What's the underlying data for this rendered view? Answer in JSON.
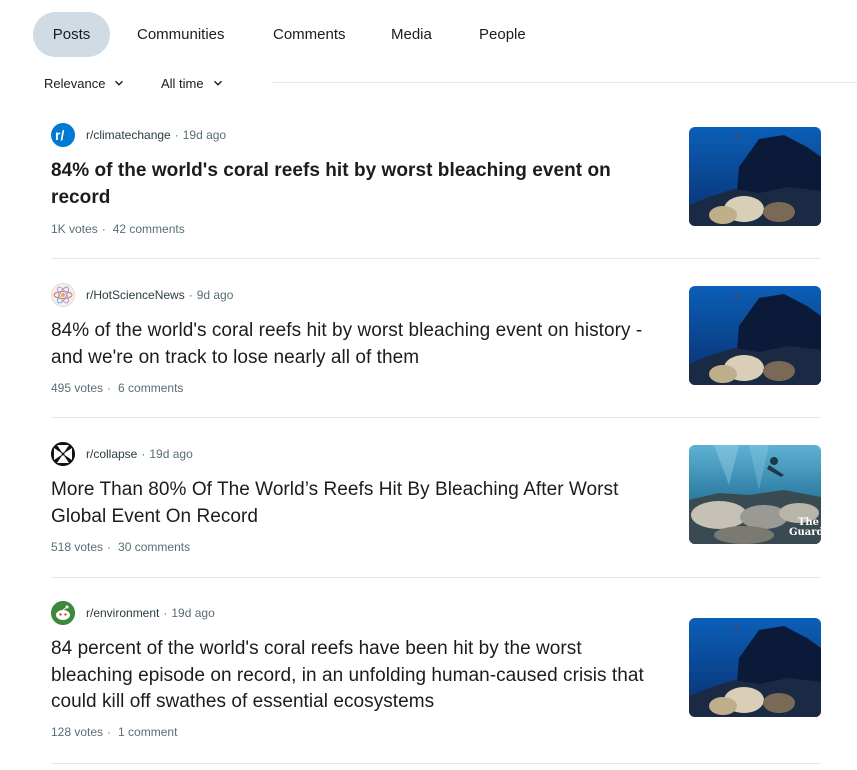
{
  "tabs": [
    {
      "label": "Posts",
      "active": true
    },
    {
      "label": "Communities",
      "active": false
    },
    {
      "label": "Comments",
      "active": false
    },
    {
      "label": "Media",
      "active": false
    },
    {
      "label": "People",
      "active": false
    }
  ],
  "filters": {
    "sort": "Relevance",
    "time": "All time"
  },
  "posts": [
    {
      "subreddit": "r/climatechange",
      "age": "19d ago",
      "title": "84% of the world's coral reefs hit by worst bleaching event on record",
      "votes": "1K votes",
      "comments": "42 comments",
      "icon": "climatechange-community-icon",
      "thumbnail": "coral-reef-thumbnail"
    },
    {
      "subreddit": "r/HotScienceNews",
      "age": "9d ago",
      "title": "84% of the world's coral reefs hit by worst bleaching event on history - and we're on track to lose nearly all of them",
      "votes": "495 votes",
      "comments": "6 comments",
      "icon": "atom-community-icon",
      "thumbnail": "coral-reef-thumbnail"
    },
    {
      "subreddit": "r/collapse",
      "age": "19d ago",
      "title": "More Than 80% Of The World’s Reefs Hit By Bleaching After Worst Global Event On Record",
      "votes": "518 votes",
      "comments": "30 comments",
      "icon": "cross-community-icon",
      "thumbnail": "diver-reef-thumbnail",
      "thumbnail_watermark": "The Guardian"
    },
    {
      "subreddit": "r/environment",
      "age": "19d ago",
      "title": "84 percent of the world's coral reefs have been hit by the worst bleaching episode on record, in an unfolding human-caused crisis that could kill off swathes of essential ecosystems",
      "votes": "128 votes",
      "comments": "1 comment",
      "icon": "snoo-community-icon",
      "thumbnail": "coral-reef-thumbnail"
    }
  ],
  "colors": {
    "active_tab_bg": "#d0dbe3",
    "meta_text": "#576f76",
    "divider": "#e4e7e9",
    "climatechange_icon": "#0079d3"
  }
}
